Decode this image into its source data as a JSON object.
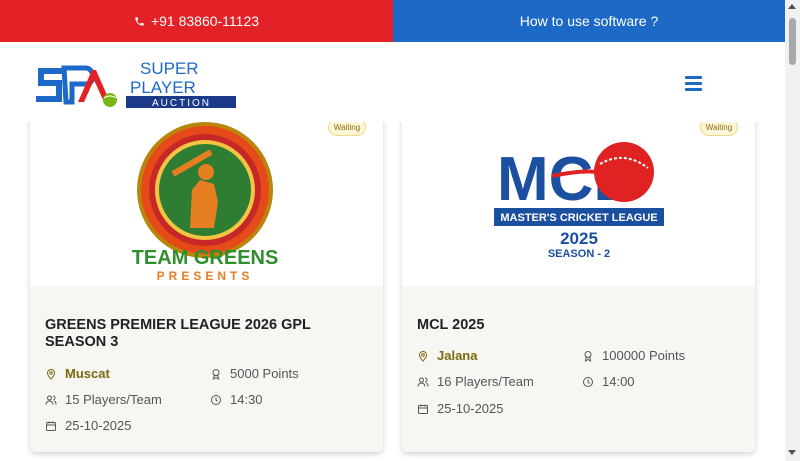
{
  "topbar": {
    "phone": "+91 83860-11123",
    "phone_icon": "phone-icon",
    "howto": "How to use software ?"
  },
  "header": {
    "logo_text_1": "SUPER",
    "logo_text_2": "PLAYER",
    "logo_text_3": "AUCTION",
    "menu_icon": "hamburger-menu-icon"
  },
  "cards": [
    {
      "status": "Waiting",
      "title": "GREENS PREMIER LEAGUE 2026 GPL SEASON 3",
      "location": "Muscat",
      "points": "5000 Points",
      "players": "15 Players/Team",
      "time": "14:30",
      "date": "25-10-2025",
      "logo_top": "TEAM GREENS",
      "logo_bottom": "PRESENTS"
    },
    {
      "status": "Waiting",
      "title": "MCL 2025",
      "location": "Jalana",
      "points": "100000 Points",
      "players": "16 Players/Team",
      "time": "14:00",
      "date": "25-10-2025",
      "logo_main": "MCL",
      "logo_sub": "MASTER'S CRICKET LEAGUE",
      "logo_year": "2025",
      "logo_season": "SEASON - 2"
    }
  ],
  "colors": {
    "topbar_left": "#e32227",
    "topbar_right": "#1d69c7",
    "accent_location": "#7a6a10",
    "team_green": "#2f8f2f",
    "mcl_blue": "#1b4fa0",
    "mcl_red": "#e02222"
  }
}
